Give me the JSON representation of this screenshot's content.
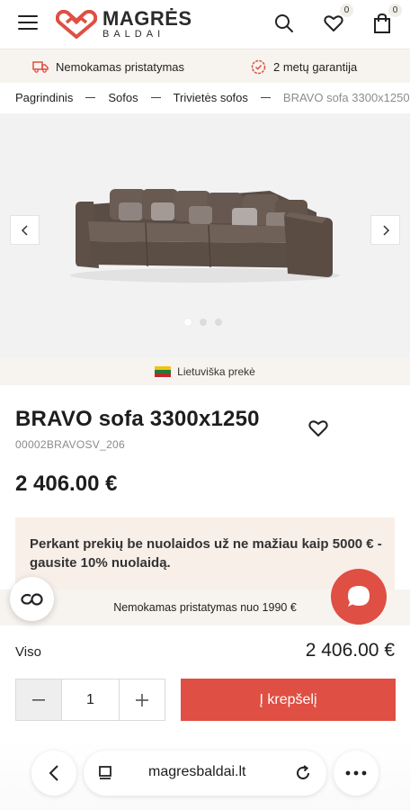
{
  "header": {
    "logo_main": "MAGRĖS",
    "logo_sub": "BALDAI",
    "wishlist_count": "0",
    "cart_count": "0",
    "icons": [
      "menu-icon",
      "search-icon",
      "heart-icon",
      "bag-icon"
    ]
  },
  "benefits": {
    "shipping": "Nemokamas pristatymas",
    "warranty": "2 metų garantija"
  },
  "breadcrumb": [
    "Pagrindinis",
    "Sofos",
    "Trivietės sofos",
    "BRAVO sofa 3300x1250"
  ],
  "gallery": {
    "slide_count": 3,
    "active_slide": 1,
    "origin_label": "Lietuviška prekė"
  },
  "product": {
    "title": "BRAVO sofa 3300x1250",
    "sku": "00002BRAVOSV_206",
    "price": "2 406.00 €"
  },
  "promo": {
    "text": "Perkant prekių be nuolaidos už ne mažiau kaip 5000 € - gausite 10% nuolaidą."
  },
  "shipping_bar": {
    "text": "Nemokamas pristatymas nuo 1990 €"
  },
  "purchase": {
    "total_label": "Viso",
    "total_value": "2 406.00 €",
    "quantity": "1",
    "add_to_cart": "Į krepšelį"
  },
  "browser": {
    "url": "magresbaldai.lt"
  },
  "colors": {
    "accent": "#df4f43",
    "beige_bar": "#f7f4ef",
    "promo_bg": "#f8efe9",
    "gallery_bg": "#f2f2f3"
  }
}
